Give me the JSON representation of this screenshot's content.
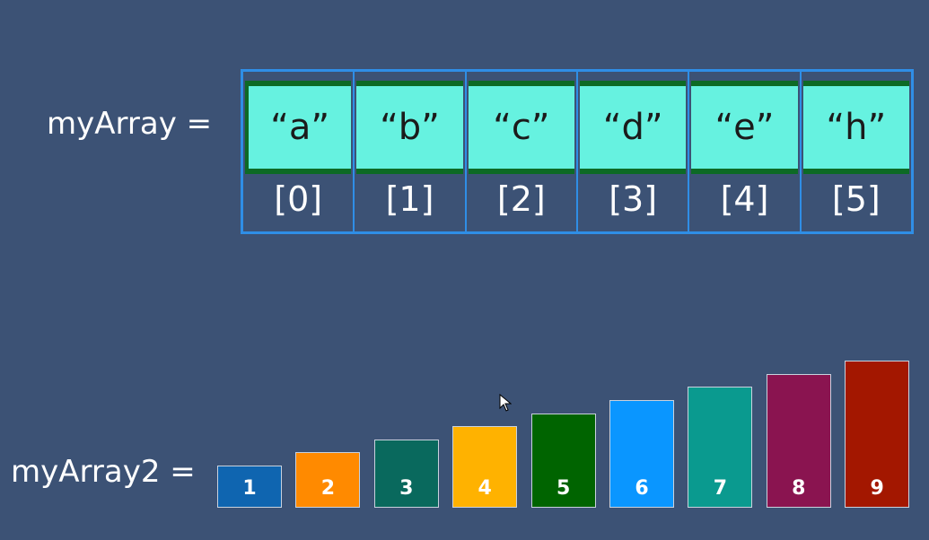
{
  "array1": {
    "label": "myArray =",
    "elements": [
      "“a”",
      "“b”",
      "“c”",
      "“d”",
      "“e”",
      "“h”"
    ],
    "indices": [
      "[0]",
      "[1]",
      "[2]",
      "[3]",
      "[4]",
      "[5]"
    ]
  },
  "array2": {
    "label": "myArray2 =",
    "bars": [
      {
        "label": "1",
        "value": 1,
        "color": "#0f65b0"
      },
      {
        "label": "2",
        "value": 2,
        "color": "#ff8a00"
      },
      {
        "label": "3",
        "value": 3,
        "color": "#09695d"
      },
      {
        "label": "4",
        "value": 4,
        "color": "#ffb200"
      },
      {
        "label": "5",
        "value": 5,
        "color": "#006400"
      },
      {
        "label": "6",
        "value": 6,
        "color": "#0a96ff"
      },
      {
        "label": "7",
        "value": 7,
        "color": "#0a9a8f"
      },
      {
        "label": "8",
        "value": 8,
        "color": "#8a1450"
      },
      {
        "label": "9",
        "value": 9,
        "color": "#a31700"
      }
    ]
  },
  "colors": {
    "background": "#3c5275",
    "grid_border": "#2f8ee6",
    "cell_fill": "#66f2e0",
    "cell_accent": "#0d6a25"
  },
  "icons": {
    "cursor": "mouse-pointer-icon"
  }
}
